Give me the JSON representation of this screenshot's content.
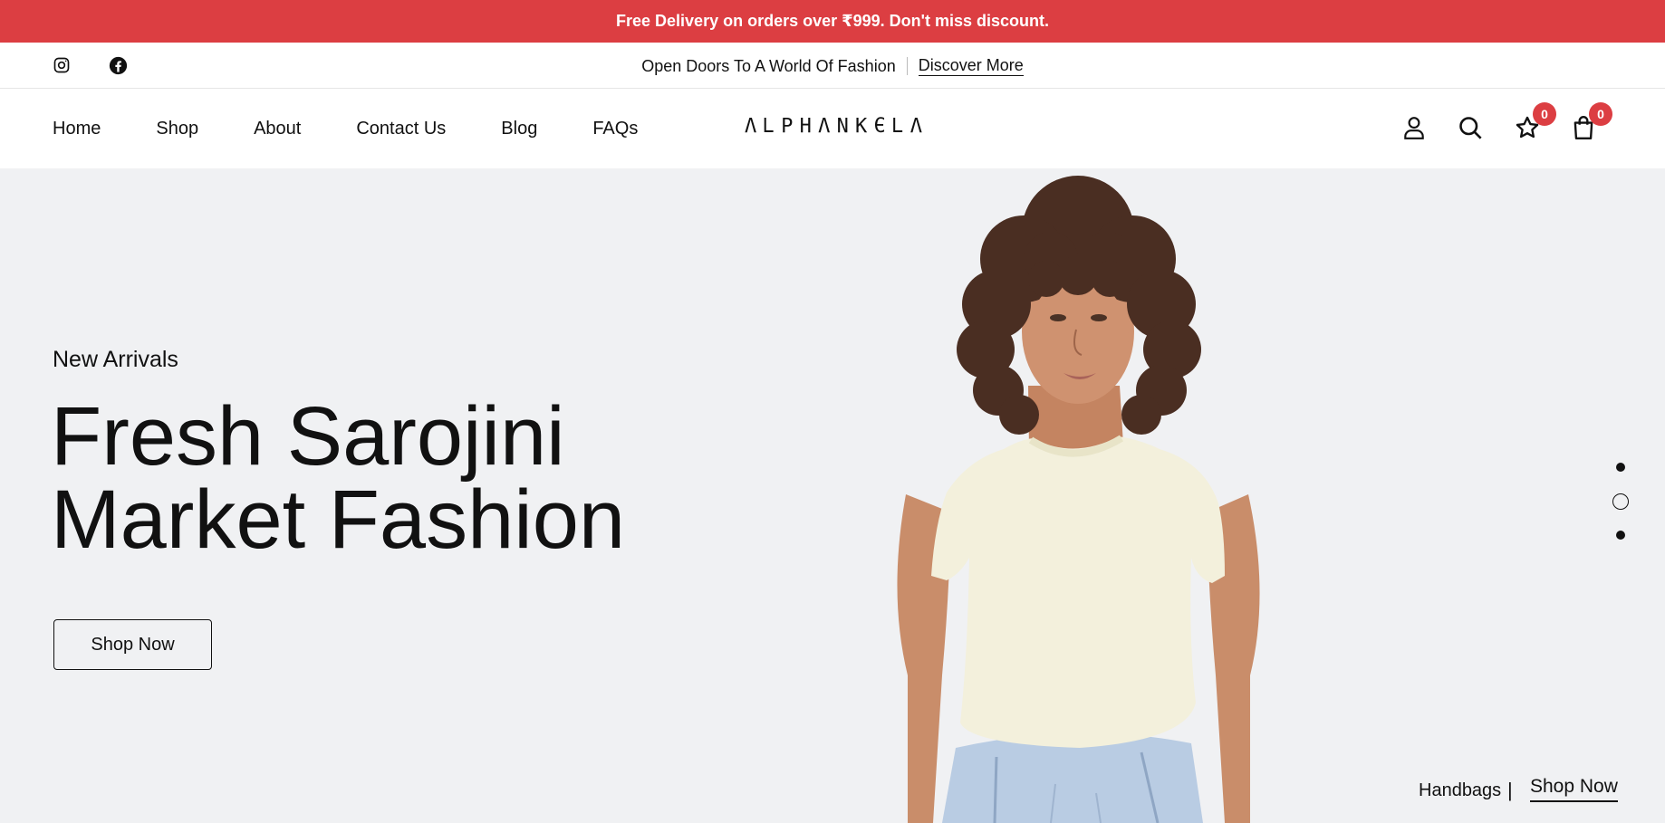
{
  "promo": {
    "text": "Free Delivery on orders over ₹999. Don't miss discount."
  },
  "top_strip": {
    "tagline": "Open Doors To A World Of Fashion",
    "discover_label": "Discover More",
    "social": [
      "instagram-icon",
      "facebook-icon"
    ]
  },
  "nav": {
    "links": [
      "Home",
      "Shop",
      "About",
      "Contact Us",
      "Blog",
      "FAQs"
    ],
    "logo_letters": [
      "Λ",
      "Ꮮ",
      "Ρ",
      "Η",
      "Λ",
      "Ν",
      "Κ",
      "Є",
      "Ꮮ",
      "Λ"
    ],
    "icons": [
      "user-icon",
      "search-icon",
      "star-icon",
      "bag-icon"
    ],
    "wishlist_count": "0",
    "cart_count": "0"
  },
  "hero": {
    "eyebrow": "New Arrivals",
    "title_line1": "Fresh Sarojini",
    "title_line2": "Market Fashion",
    "cta_label": "Shop Now",
    "slide_count": 3,
    "active_slide": 2,
    "caption_category": "Handbags",
    "caption_separator": "|",
    "caption_cta": "Shop Now"
  },
  "colors": {
    "accent": "#dc3e42",
    "hero_bg": "#f0f1f3",
    "text": "#111111"
  }
}
